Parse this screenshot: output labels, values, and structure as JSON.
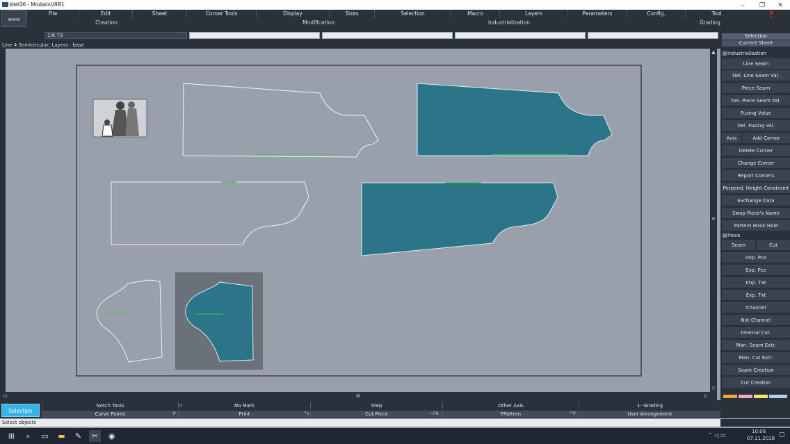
{
  "window": {
    "title": "kleit36  - ModarisV8R1",
    "minimize": "–",
    "restore": "❐",
    "close": "✕"
  },
  "menu": {
    "www": "www",
    "items": [
      "File",
      "Edit",
      "Sheet",
      "Corner Tools",
      "Display",
      "Sizes",
      "Selection",
      "Macro",
      "Layers",
      "Parameters",
      "Config.",
      "Tool"
    ],
    "sub": [
      "Creation",
      "Modification",
      "Industrialization",
      "Grading"
    ],
    "help_icon": "?"
  },
  "scale": "1/6.79",
  "status": "Line 4  Semicircular;   Layers :  base",
  "panel": {
    "head1": "Selection",
    "head2": "Current Sheet",
    "sec1": "Industrialisation",
    "buttons1": [
      "Line Seam",
      "Del. Line Seam Val.",
      "Piece Seam",
      "Del. Piece Seam Val.",
      "Fusing Value",
      "Del. Fusing Val."
    ],
    "axis": "Axis",
    "add_corner": "Add Corner",
    "buttons2": [
      "Delete Corner",
      "Change Corner",
      "Report Corners",
      "Perpend. Height Constraint",
      "Exchange Data",
      "Swap Piece's Name",
      "Pattern Hook Hole"
    ],
    "sec2": "Piece",
    "seam": "Seam",
    "cut": "Cut",
    "buttons3": [
      "Imp. Pce",
      "Exp. Pce",
      "Imp. Txt",
      "Exp. Txt",
      "Channel",
      "Not Channel",
      "Internal Cut.",
      "Man. Seam Extr.",
      "Man. Cut Extr.",
      "Seam Creation",
      "Cut Creation"
    ]
  },
  "toolbar": {
    "selection": "Selection",
    "row1": [
      "Notch Tools",
      "No Mark",
      "Step",
      "Other Axis",
      "1- Grading"
    ],
    "row1_shortcuts": [
      "u",
      "",
      "",
      "",
      ""
    ],
    "row2": [
      "Curve Points",
      "Print",
      "Cut Piece",
      "FPattern",
      "User Arrangement"
    ],
    "row2_shortcuts": [
      "P",
      "^c",
      "~F9",
      "^P",
      ""
    ]
  },
  "hint": "Select objects",
  "clock": {
    "time": "10:08",
    "date": "07.11.2018"
  },
  "colors": {
    "piece_fill": "#2c7488",
    "canvas": "#9aa0ab",
    "accent": "#37b4e6"
  }
}
